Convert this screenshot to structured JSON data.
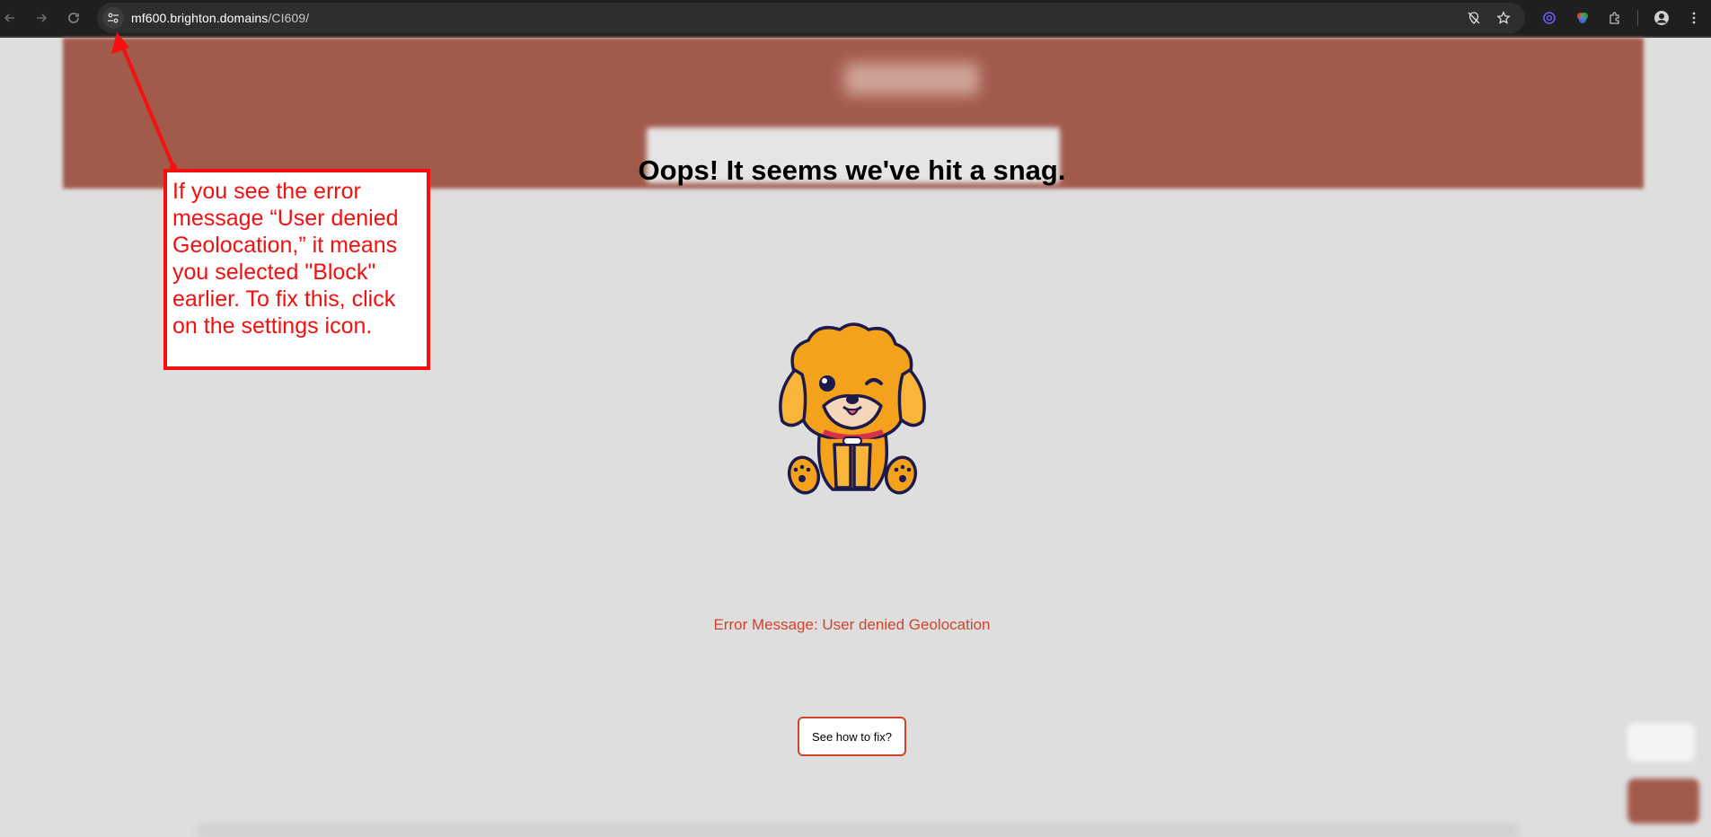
{
  "browser": {
    "url_host": "mf600.brighton.domains",
    "url_path": "/CI609/",
    "icons": {
      "back": "arrow-left-icon",
      "forward": "arrow-right-icon",
      "reload": "reload-icon",
      "site_info": "tune-settings-icon",
      "location_blocked": "location-off-icon",
      "bookmark": "star-icon",
      "extension_1": "at-sign-icon",
      "extension_2": "colorwheel-icon",
      "extensions": "puzzle-icon",
      "profile": "person-icon",
      "menu": "kebab-menu-icon"
    }
  },
  "page": {
    "headline": "Oops! It seems we've hit a snag.",
    "error_message": "Error Message: User denied Geolocation",
    "fix_button_label": "See how to fix?",
    "illustration": "cute-dog-illustration"
  },
  "annotation": {
    "text": "If you see the error message “User denied Geolocation,” it means you selected \"Block\" earlier. To fix this, click on the settings icon.",
    "color": "#f50f0f"
  },
  "colors": {
    "header_brown": "#a25a4b",
    "error_red": "#d0442d",
    "page_bg": "#dedede"
  }
}
